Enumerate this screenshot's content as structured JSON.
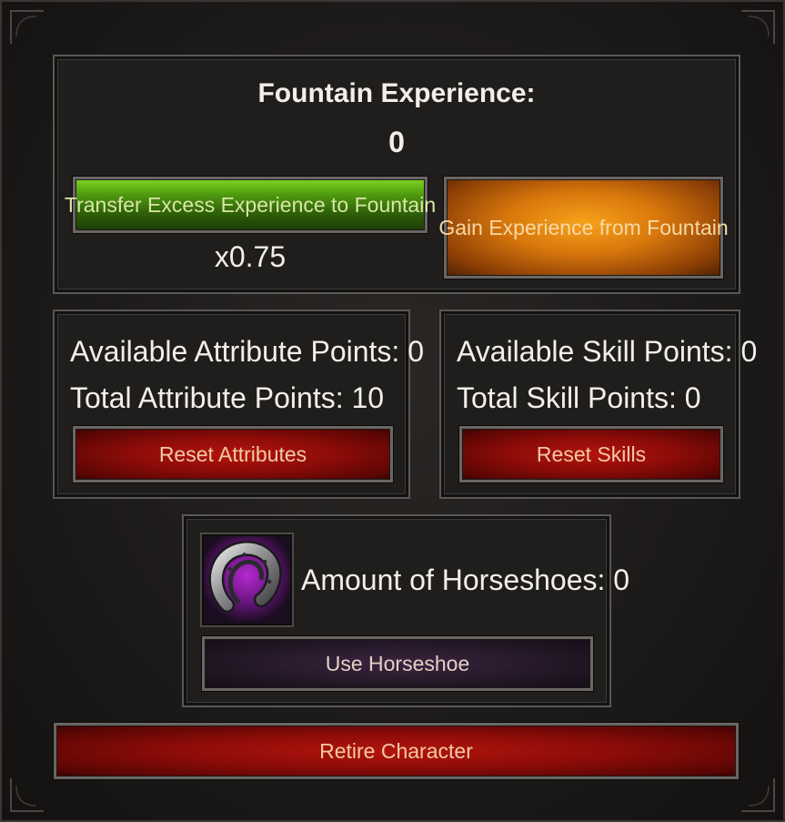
{
  "fountain": {
    "title": "Fountain Experience:",
    "value": "0",
    "transfer_button": "Transfer Excess Experience to Fountain",
    "multiplier": "x0.75",
    "gain_button": "Gain Experience from Fountain"
  },
  "attributes": {
    "available": "Available Attribute Points: 0",
    "total": "Total Attribute Points: 10",
    "reset_button": "Reset Attributes"
  },
  "skills": {
    "available": "Available Skill Points: 0",
    "total": "Total Skill Points: 0",
    "reset_button": "Reset Skills"
  },
  "horseshoes": {
    "icon": "horseshoe-icon",
    "amount": "Amount of Horseshoes: 0",
    "use_button": "Use Horseshoe"
  },
  "retire_button": "Retire Character",
  "colors": {
    "green_button": "#4f9a10",
    "orange_button": "#d9770c",
    "red_button": "#8e0c08",
    "purple_button": "#251828",
    "panel_bg": "#1f1e1d"
  }
}
